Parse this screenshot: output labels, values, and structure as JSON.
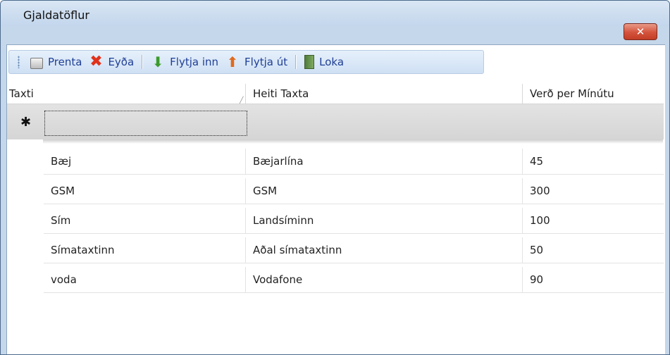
{
  "window": {
    "title": "Gjaldatöflur",
    "close_glyph": "✕"
  },
  "toolbar": {
    "buttons": [
      {
        "label": "Prenta",
        "icon": "print-icon"
      },
      {
        "label": "Eyða",
        "icon": "delete-icon"
      },
      {
        "label": "Flytja inn",
        "icon": "import-icon"
      },
      {
        "label": "Flytja út",
        "icon": "export-icon"
      },
      {
        "label": "Loka",
        "icon": "close-door-icon"
      }
    ]
  },
  "grid": {
    "columns": [
      "Taxti",
      "Heiti Taxta",
      "Verð per Mínútu"
    ],
    "new_row_marker": "✱",
    "rows": [
      {
        "taxti": "Bæj",
        "heiti": "Bæjarlína",
        "verd": "45"
      },
      {
        "taxti": "GSM",
        "heiti": "GSM",
        "verd": "300"
      },
      {
        "taxti": "Sím",
        "heiti": "Landsíminn",
        "verd": "100"
      },
      {
        "taxti": "Símataxtinn",
        "heiti": "Aðal símataxtinn",
        "verd": "50"
      },
      {
        "taxti": "voda",
        "heiti": "Vodafone",
        "verd": "90"
      }
    ]
  },
  "colors": {
    "frame": "#c5d7ea",
    "toolbar_text": "#1f3e96",
    "close_button": "#d3533c"
  }
}
